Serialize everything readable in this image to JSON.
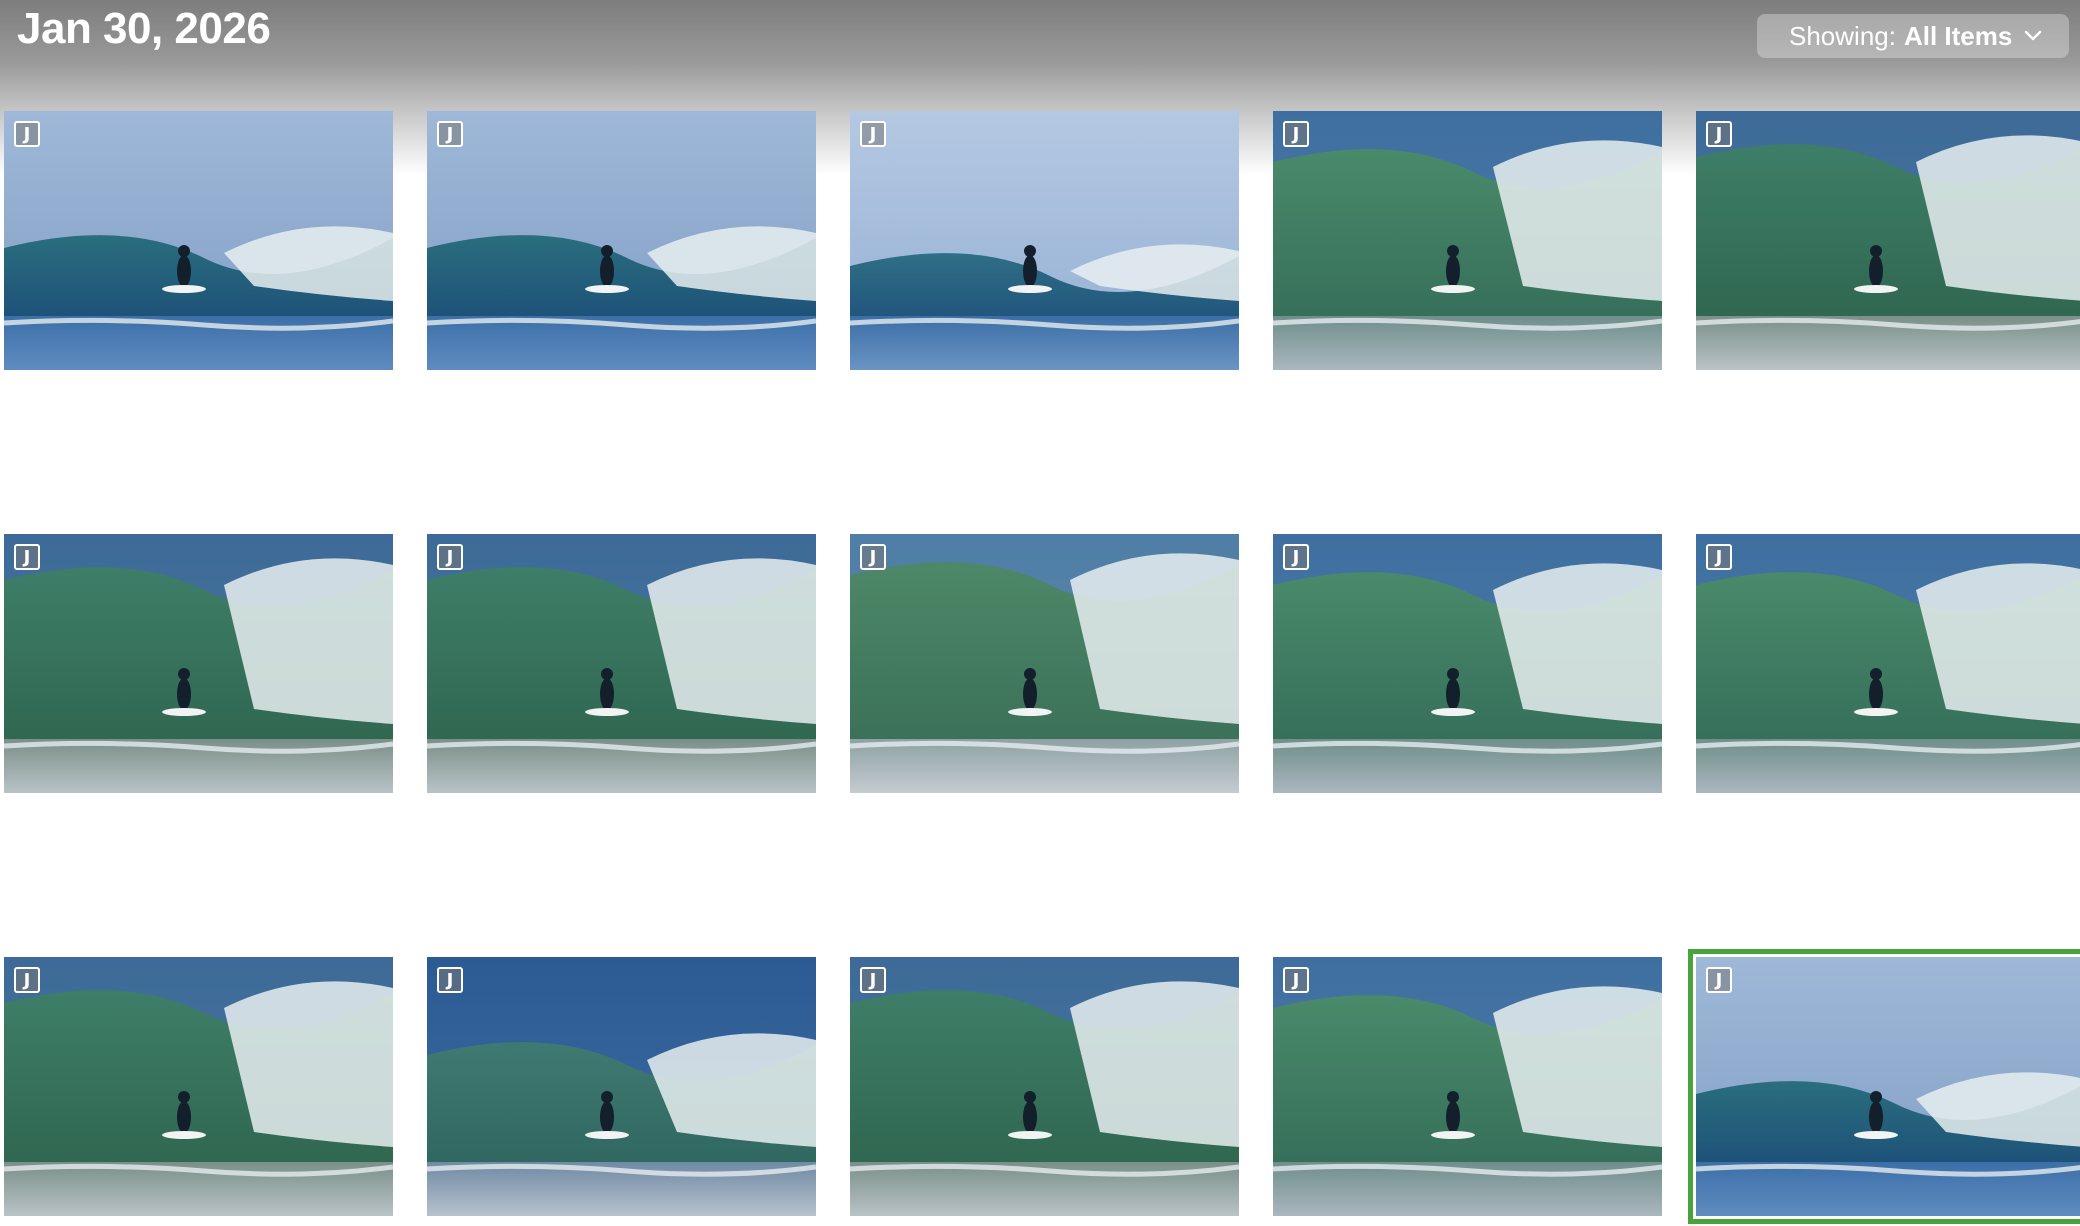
{
  "header": {
    "date": "Jan 30, 2026",
    "filter_prefix": "Showing:",
    "filter_value": "All Items"
  },
  "colors": {
    "selection": "#4aa33a"
  },
  "photos": [
    {
      "badge": "J",
      "scene": "blue-barrel",
      "selected": false
    },
    {
      "badge": "J",
      "scene": "blue-barrel",
      "selected": false
    },
    {
      "badge": "J",
      "scene": "blue-peak",
      "selected": false
    },
    {
      "badge": "J",
      "scene": "green-spray",
      "selected": false
    },
    {
      "badge": "J",
      "scene": "green-curl",
      "selected": false
    },
    {
      "badge": "J",
      "scene": "green-curl",
      "selected": false
    },
    {
      "badge": "J",
      "scene": "green-curl",
      "selected": false
    },
    {
      "badge": "J",
      "scene": "whitewater",
      "selected": false
    },
    {
      "badge": "J",
      "scene": "green-spray",
      "selected": false
    },
    {
      "badge": "J",
      "scene": "green-spray",
      "selected": false
    },
    {
      "badge": "J",
      "scene": "green-curl",
      "selected": false
    },
    {
      "badge": "J",
      "scene": "air",
      "selected": false
    },
    {
      "badge": "J",
      "scene": "green-curl",
      "selected": false
    },
    {
      "badge": "J",
      "scene": "green-spray",
      "selected": false
    },
    {
      "badge": "J",
      "scene": "blue-barrel",
      "selected": true
    }
  ]
}
